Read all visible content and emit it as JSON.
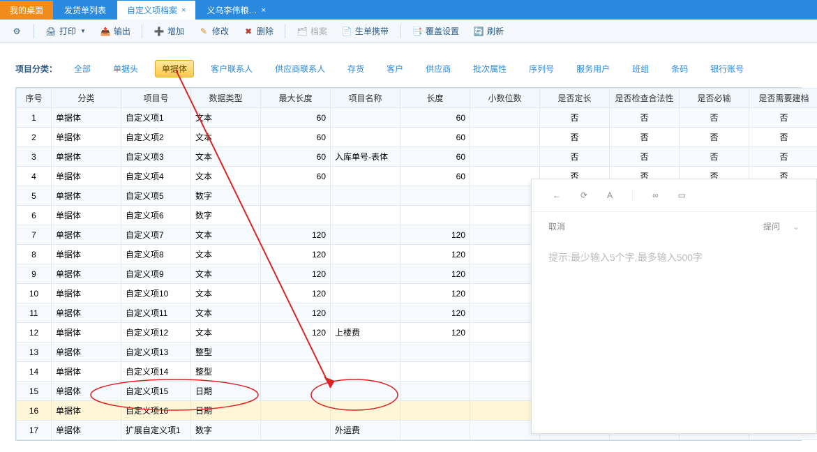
{
  "tabs": [
    {
      "label": "我的桌面"
    },
    {
      "label": "发货单列表"
    },
    {
      "label": "自定义项档案"
    },
    {
      "label": "义乌李伟粮…"
    }
  ],
  "toolbar": {
    "print": "打印",
    "export": "输出",
    "add": "增加",
    "edit": "修改",
    "delete": "删除",
    "archive": "档案",
    "gen": "生单携带",
    "cover": "覆盖设置",
    "refresh": "刷新"
  },
  "filter": {
    "label": "项目分类：",
    "items": [
      "全部",
      "单据头",
      "单据体",
      "客户联系人",
      "供应商联系人",
      "存货",
      "客户",
      "供应商",
      "批次属性",
      "序列号",
      "服务用户",
      "班组",
      "条码",
      "银行账号"
    ]
  },
  "columns": [
    "序号",
    "分类",
    "项目号",
    "数据类型",
    "最大长度",
    "项目名称",
    "长度",
    "小数位数",
    "是否定长",
    "是否检查合法性",
    "是否必输",
    "是否需要建档"
  ],
  "rows": [
    {
      "seq": 1,
      "cat": "单据体",
      "id": "自定义项1",
      "type": "文本",
      "maxlen": 60,
      "name": "",
      "len": 60,
      "dec": "",
      "fix": "否",
      "chk": "否",
      "req": "否",
      "file": "否"
    },
    {
      "seq": 2,
      "cat": "单据体",
      "id": "自定义项2",
      "type": "文本",
      "maxlen": 60,
      "name": "",
      "len": 60,
      "dec": "",
      "fix": "否",
      "chk": "否",
      "req": "否",
      "file": "否"
    },
    {
      "seq": 3,
      "cat": "单据体",
      "id": "自定义项3",
      "type": "文本",
      "maxlen": 60,
      "name": "入库单号-表体",
      "len": 60,
      "dec": "",
      "fix": "否",
      "chk": "否",
      "req": "否",
      "file": "否"
    },
    {
      "seq": 4,
      "cat": "单据体",
      "id": "自定义项4",
      "type": "文本",
      "maxlen": 60,
      "name": "",
      "len": 60,
      "dec": "",
      "fix": "否",
      "chk": "否",
      "req": "否",
      "file": "否"
    },
    {
      "seq": 5,
      "cat": "单据体",
      "id": "自定义项5",
      "type": "数字",
      "maxlen": "",
      "name": "",
      "len": "",
      "dec": "",
      "fix": "",
      "chk": "",
      "req": "",
      "file": ""
    },
    {
      "seq": 6,
      "cat": "单据体",
      "id": "自定义项6",
      "type": "数字",
      "maxlen": "",
      "name": "",
      "len": "",
      "dec": "",
      "fix": "",
      "chk": "",
      "req": "",
      "file": ""
    },
    {
      "seq": 7,
      "cat": "单据体",
      "id": "自定义项7",
      "type": "文本",
      "maxlen": 120,
      "name": "",
      "len": 120,
      "dec": "",
      "fix": "",
      "chk": "",
      "req": "",
      "file": ""
    },
    {
      "seq": 8,
      "cat": "单据体",
      "id": "自定义项8",
      "type": "文本",
      "maxlen": 120,
      "name": "",
      "len": 120,
      "dec": "",
      "fix": "",
      "chk": "",
      "req": "",
      "file": ""
    },
    {
      "seq": 9,
      "cat": "单据体",
      "id": "自定义项9",
      "type": "文本",
      "maxlen": 120,
      "name": "",
      "len": 120,
      "dec": "",
      "fix": "",
      "chk": "",
      "req": "",
      "file": ""
    },
    {
      "seq": 10,
      "cat": "单据体",
      "id": "自定义项10",
      "type": "文本",
      "maxlen": 120,
      "name": "",
      "len": 120,
      "dec": "",
      "fix": "",
      "chk": "",
      "req": "",
      "file": ""
    },
    {
      "seq": 11,
      "cat": "单据体",
      "id": "自定义项11",
      "type": "文本",
      "maxlen": 120,
      "name": "",
      "len": 120,
      "dec": "",
      "fix": "",
      "chk": "",
      "req": "",
      "file": ""
    },
    {
      "seq": 12,
      "cat": "单据体",
      "id": "自定义项12",
      "type": "文本",
      "maxlen": 120,
      "name": "上楼费",
      "len": 120,
      "dec": "",
      "fix": "",
      "chk": "",
      "req": "",
      "file": ""
    },
    {
      "seq": 13,
      "cat": "单据体",
      "id": "自定义项13",
      "type": "整型",
      "maxlen": "",
      "name": "",
      "len": "",
      "dec": "",
      "fix": "",
      "chk": "",
      "req": "",
      "file": ""
    },
    {
      "seq": 14,
      "cat": "单据体",
      "id": "自定义项14",
      "type": "整型",
      "maxlen": "",
      "name": "",
      "len": "",
      "dec": "",
      "fix": "",
      "chk": "",
      "req": "",
      "file": ""
    },
    {
      "seq": 15,
      "cat": "单据体",
      "id": "自定义项15",
      "type": "日期",
      "maxlen": "",
      "name": "",
      "len": "",
      "dec": "",
      "fix": "",
      "chk": "",
      "req": "",
      "file": ""
    },
    {
      "seq": 16,
      "cat": "单据体",
      "id": "自定义项16",
      "type": "日期",
      "maxlen": "",
      "name": "",
      "len": "",
      "dec": "",
      "fix": "",
      "chk": "",
      "req": "",
      "file": ""
    },
    {
      "seq": 17,
      "cat": "单据体",
      "id": "扩展自定义项1",
      "type": "数字",
      "maxlen": "",
      "name": "外运费",
      "len": "",
      "dec": "",
      "fix": "",
      "chk": "",
      "req": "",
      "file": ""
    }
  ],
  "popup": {
    "cancel": "取消",
    "ask": "提问",
    "hint": "提示:最少输入5个字,最多输入500字"
  }
}
